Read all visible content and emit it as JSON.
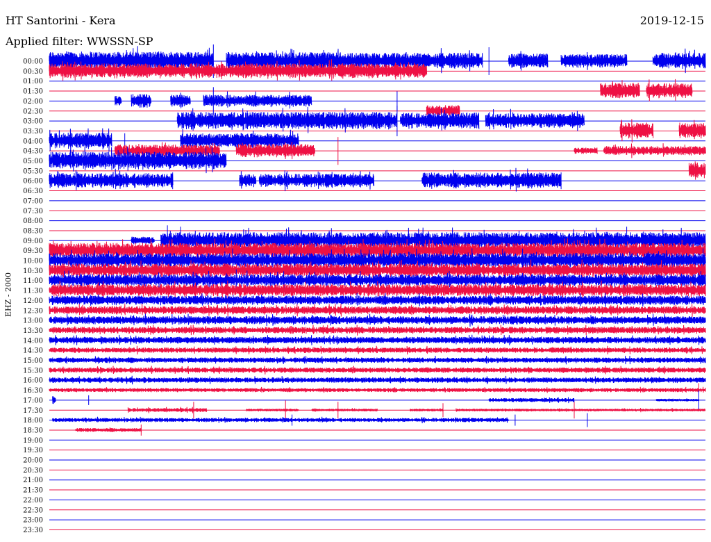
{
  "header": {
    "station": "HT Santorini - Kera",
    "date": "2019-12-15",
    "filter": "Applied filter: WWSSN-SP",
    "channel": "EHZ - 2000"
  },
  "colors": {
    "even_row": "#0000ee",
    "odd_row": "#ee1144",
    "text": "#000000"
  },
  "chart_data": {
    "type": "helicorder",
    "x_minutes_per_row": 30,
    "row_labels": [
      "00:00",
      "00:30",
      "01:00",
      "01:30",
      "02:00",
      "02:30",
      "03:00",
      "03:30",
      "04:00",
      "04:30",
      "05:00",
      "05:30",
      "06:00",
      "06:30",
      "07:00",
      "07:30",
      "08:00",
      "08:30",
      "09:00",
      "09:30",
      "10:00",
      "10:30",
      "11:00",
      "11:30",
      "12:00",
      "12:30",
      "13:00",
      "13:30",
      "14:00",
      "14:30",
      "15:00",
      "15:30",
      "16:00",
      "16:30",
      "17:00",
      "17:30",
      "18:00",
      "18:30",
      "19:00",
      "19:30",
      "20:00",
      "20:30",
      "21:00",
      "21:30",
      "22:00",
      "22:30",
      "23:00",
      "23:30"
    ],
    "row_colors_cycle": [
      "blue",
      "red"
    ],
    "rows": [
      {
        "segments": [
          [
            0.0,
            0.25,
            14
          ],
          [
            0.27,
            0.45,
            13
          ],
          [
            0.45,
            0.66,
            12
          ],
          [
            0.7,
            0.76,
            11
          ],
          [
            0.78,
            0.88,
            10
          ],
          [
            0.92,
            1.0,
            12
          ]
        ],
        "spikes": [
          [
            0.25,
            24
          ],
          [
            0.44,
            15
          ],
          [
            0.67,
            20
          ]
        ]
      },
      {
        "segments": [
          [
            0.0,
            0.575,
            11
          ]
        ],
        "spikes": []
      },
      {
        "segments": [],
        "spikes": []
      },
      {
        "segments": [
          [
            0.84,
            0.9,
            12
          ],
          [
            0.91,
            0.98,
            11
          ]
        ],
        "spikes": []
      },
      {
        "segments": [
          [
            0.1,
            0.11,
            9
          ],
          [
            0.125,
            0.155,
            10
          ],
          [
            0.185,
            0.215,
            9
          ],
          [
            0.235,
            0.4,
            9
          ]
        ],
        "spikes": [
          [
            0.25,
            20
          ],
          [
            0.53,
            14
          ]
        ]
      },
      {
        "segments": [
          [
            0.575,
            0.625,
            9
          ]
        ],
        "spikes": []
      },
      {
        "segments": [
          [
            0.195,
            0.53,
            13
          ],
          [
            0.535,
            0.655,
            12
          ],
          [
            0.665,
            0.815,
            11
          ]
        ],
        "spikes": [
          [
            0.53,
            22
          ],
          [
            0.75,
            10
          ]
        ]
      },
      {
        "segments": [
          [
            0.87,
            0.92,
            12
          ],
          [
            0.96,
            1.0,
            12
          ]
        ],
        "spikes": []
      },
      {
        "segments": [
          [
            0.0,
            0.095,
            12
          ],
          [
            0.2,
            0.38,
            11
          ]
        ],
        "spikes": [
          [
            0.115,
            11
          ]
        ]
      },
      {
        "segments": [
          [
            0.1,
            0.26,
            9
          ],
          [
            0.285,
            0.405,
            10
          ],
          [
            0.8,
            0.835,
            5
          ],
          [
            0.845,
            1.0,
            7
          ]
        ],
        "spikes": [
          [
            0.44,
            20
          ]
        ]
      },
      {
        "segments": [
          [
            0.0,
            0.27,
            13
          ]
        ],
        "spikes": []
      },
      {
        "segments": [
          [
            0.975,
            1.0,
            12
          ]
        ],
        "spikes": []
      },
      {
        "segments": [
          [
            0.0,
            0.188,
            11
          ],
          [
            0.29,
            0.315,
            10
          ],
          [
            0.32,
            0.495,
            10
          ],
          [
            0.568,
            0.78,
            12
          ]
        ],
        "spikes": [
          [
            0.188,
            12
          ],
          [
            0.78,
            12
          ]
        ]
      },
      {
        "segments": [],
        "spikes": []
      },
      {
        "segments": [],
        "spikes": []
      },
      {
        "segments": [],
        "spikes": []
      },
      {
        "segments": [],
        "spikes": []
      },
      {
        "segments": [],
        "spikes": []
      },
      {
        "segments": [
          [
            0.125,
            0.16,
            6
          ],
          [
            0.17,
            1.0,
            12
          ]
        ],
        "spikes": [
          [
            0.18,
            22
          ],
          [
            0.2,
            20
          ],
          [
            0.43,
            18
          ],
          [
            0.88,
            20
          ]
        ]
      },
      {
        "segments": [
          [
            0.0,
            1.0,
            11
          ]
        ],
        "spikes": [
          [
            0.8,
            14
          ]
        ]
      },
      {
        "segments": [
          [
            0.0,
            1.0,
            11
          ]
        ],
        "spikes": []
      },
      {
        "segments": [
          [
            0.0,
            1.0,
            10
          ]
        ],
        "spikes": []
      },
      {
        "segments": [
          [
            0.0,
            1.0,
            9
          ]
        ],
        "spikes": [
          [
            0.285,
            16
          ]
        ]
      },
      {
        "segments": [
          [
            0.0,
            1.0,
            9
          ]
        ],
        "spikes": []
      },
      {
        "segments": [
          [
            0.0,
            1.0,
            7
          ]
        ],
        "spikes": []
      },
      {
        "segments": [
          [
            0.0,
            1.0,
            6
          ]
        ],
        "spikes": []
      },
      {
        "segments": [
          [
            0.0,
            1.0,
            6
          ]
        ],
        "spikes": []
      },
      {
        "segments": [
          [
            0.0,
            1.0,
            5
          ]
        ],
        "spikes": []
      },
      {
        "segments": [
          [
            0.0,
            1.0,
            5
          ]
        ],
        "spikes": []
      },
      {
        "segments": [
          [
            0.0,
            1.0,
            4
          ]
        ],
        "spikes": []
      },
      {
        "segments": [
          [
            0.0,
            1.0,
            4
          ]
        ],
        "spikes": []
      },
      {
        "segments": [
          [
            0.0,
            1.0,
            4
          ]
        ],
        "spikes": []
      },
      {
        "segments": [
          [
            0.0,
            1.0,
            4
          ]
        ],
        "spikes": []
      },
      {
        "segments": [
          [
            0.0,
            1.0,
            3
          ]
        ],
        "spikes": [
          [
            0.99,
            10
          ]
        ]
      },
      {
        "segments": [
          [
            0.005,
            0.01,
            6
          ],
          [
            0.67,
            0.8,
            3
          ],
          [
            0.925,
            0.99,
            2
          ]
        ],
        "spikes": [
          [
            0.06,
            7
          ],
          [
            0.99,
            14
          ]
        ]
      },
      {
        "segments": [
          [
            0.12,
            0.24,
            3
          ],
          [
            0.3,
            0.38,
            2
          ],
          [
            0.4,
            0.5,
            2
          ],
          [
            0.55,
            0.6,
            2
          ],
          [
            0.62,
            1.0,
            2
          ]
        ],
        "spikes": [
          [
            0.22,
            12
          ],
          [
            0.36,
            14
          ],
          [
            0.44,
            12
          ],
          [
            0.6,
            10
          ],
          [
            0.8,
            12
          ]
        ]
      },
      {
        "segments": [
          [
            0.005,
            0.7,
            3
          ]
        ],
        "spikes": [
          [
            0.37,
            8
          ],
          [
            0.71,
            8
          ],
          [
            0.82,
            10
          ]
        ]
      },
      {
        "segments": [
          [
            0.04,
            0.14,
            3
          ]
        ],
        "spikes": [
          [
            0.14,
            8
          ]
        ]
      },
      {
        "segments": [],
        "spikes": []
      },
      {
        "segments": [],
        "spikes": []
      },
      {
        "segments": [],
        "spikes": []
      },
      {
        "segments": [],
        "spikes": []
      },
      {
        "segments": [],
        "spikes": []
      },
      {
        "segments": [],
        "spikes": []
      },
      {
        "segments": [],
        "spikes": []
      },
      {
        "segments": [],
        "spikes": []
      },
      {
        "segments": [],
        "spikes": []
      },
      {
        "segments": [],
        "spikes": []
      }
    ]
  }
}
